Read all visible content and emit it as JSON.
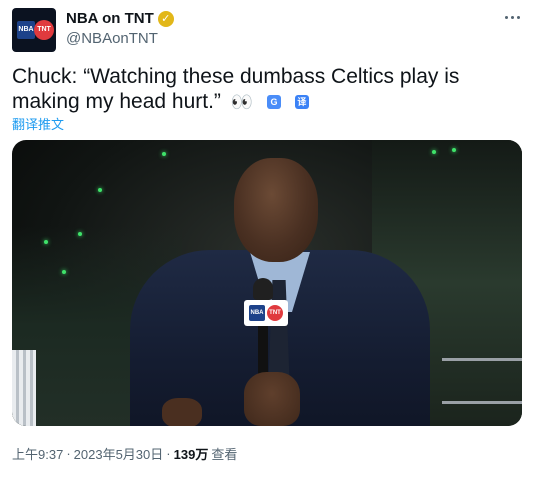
{
  "account": {
    "display_name": "NBA on TNT",
    "handle": "@NBAonTNT",
    "avatar_logo_left": "NBA",
    "avatar_logo_right": "TNT",
    "verified_color": "#e2b719"
  },
  "tweet": {
    "text": "Chuck: “Watching these dumbass Celtics play is making my head hurt.”",
    "emoji": "👀",
    "translate_label": "翻译推文"
  },
  "media": {
    "mic_flag_left": "NBA",
    "mic_flag_right": "TNT"
  },
  "meta": {
    "time": "上午9:37",
    "separator": "·",
    "date": "2023年5月30日",
    "views": "139万",
    "views_label": "查看"
  },
  "colors": {
    "link": "#1d9bf0",
    "secondary_text": "#536471",
    "primary_text": "#0f1419"
  },
  "icons": {
    "more": "more-horizontal-icon",
    "translate_badge": "google-translate-icon",
    "translate_badge_alt": "translate-icon"
  }
}
